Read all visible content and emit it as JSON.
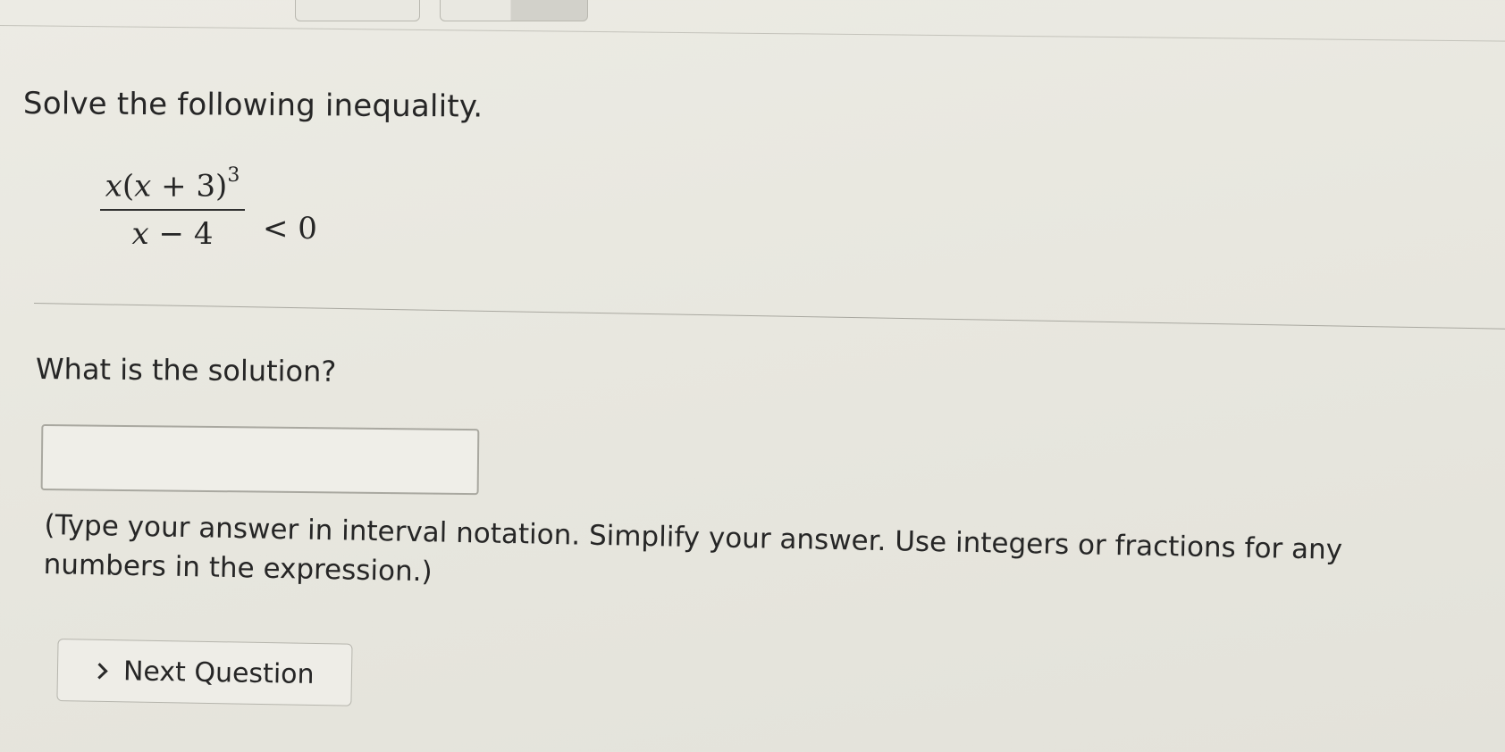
{
  "question": {
    "prompt": "Solve the following inequality.",
    "inequality": {
      "numerator_a": "x",
      "numerator_open": "(",
      "numerator_b": "x",
      "numerator_plus": " + 3)",
      "numerator_exponent": "3",
      "denominator_var": "x",
      "denominator_rest": " − 4",
      "relation": "< 0"
    }
  },
  "answer": {
    "prompt": "What is the solution?",
    "value": "",
    "instructions": "(Type your answer in interval notation. Simplify your answer. Use integers or fractions for any numbers in the expression.)"
  },
  "navigation": {
    "next_label": "Next Question",
    "next_icon": "chevron-right-icon"
  }
}
